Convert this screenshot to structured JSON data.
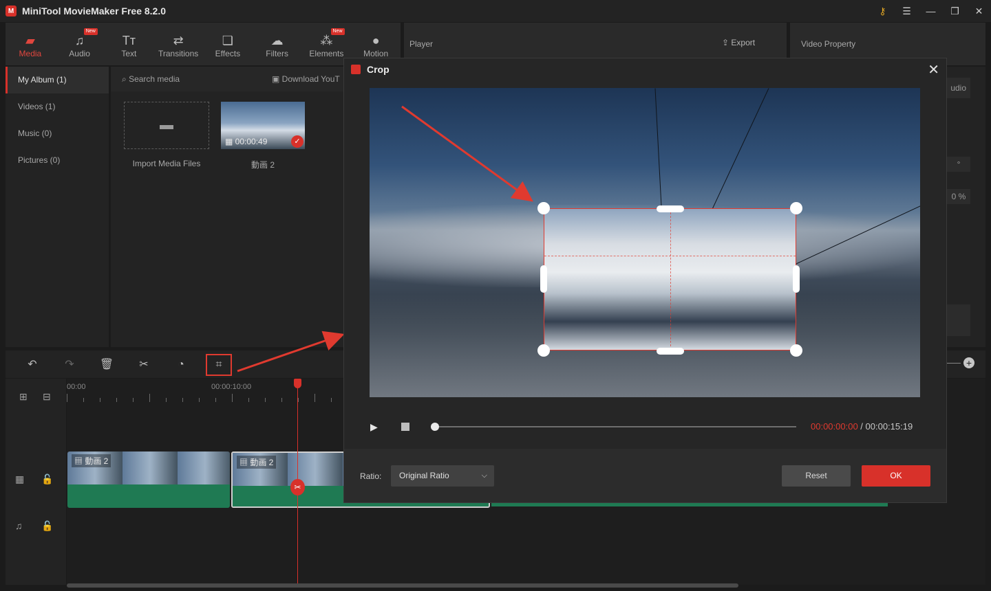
{
  "app": {
    "title": "MiniTool MovieMaker Free 8.2.0",
    "logo_icon": "minitool-logo-icon",
    "window_controls": [
      "key-icon",
      "menu-icon",
      "minimize-icon",
      "maximize-icon",
      "close-icon"
    ]
  },
  "toolbar": {
    "tabs": [
      {
        "label": "Media",
        "icon": "media-icon",
        "active": true
      },
      {
        "label": "Audio",
        "icon": "music-note-icon",
        "badge": "New"
      },
      {
        "label": "Text",
        "icon": "text-icon"
      },
      {
        "label": "Transitions",
        "icon": "transitions-icon"
      },
      {
        "label": "Effects",
        "icon": "effects-icon"
      },
      {
        "label": "Filters",
        "icon": "filters-icon"
      },
      {
        "label": "Elements",
        "icon": "elements-icon",
        "badge": "New"
      },
      {
        "label": "Motion",
        "icon": "motion-icon"
      }
    ]
  },
  "player": {
    "label": "Player",
    "export_label": "Export"
  },
  "video_property": {
    "label": "Video Property",
    "audio_tab_fragment": "udio",
    "value_fragment_1": "°",
    "value_fragment_2": "0 %"
  },
  "album_nav": {
    "items": [
      {
        "label": "My Album (1)",
        "active": true
      },
      {
        "label": "Videos (1)"
      },
      {
        "label": "Music (0)"
      },
      {
        "label": "Pictures (0)"
      }
    ]
  },
  "media": {
    "search_placeholder": "Search media",
    "download_label": "Download YouT",
    "import_label": "Import Media Files",
    "clip_duration": "00:00:49",
    "clip_name": "動画 2"
  },
  "timeline": {
    "ruler_labels": [
      "00:00",
      "00:00:10:00"
    ],
    "clips": [
      {
        "name": "動画 2"
      },
      {
        "name": "動画 2",
        "selected": true
      }
    ]
  },
  "crop_dialog": {
    "title": "Crop",
    "current_time": "00:00:00:00",
    "total_time": " / 00:00:15:19",
    "ratio_label": "Ratio:",
    "ratio_value": "Original Ratio",
    "reset_label": "Reset",
    "ok_label": "OK"
  },
  "colors": {
    "accent": "#d8312a",
    "annotation": "#e03a2f",
    "audio_track": "#1f7a53"
  }
}
